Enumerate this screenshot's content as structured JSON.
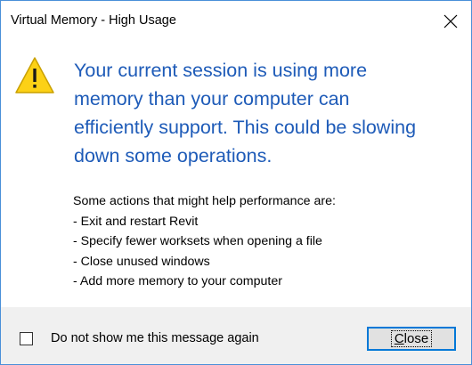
{
  "window": {
    "title": "Virtual Memory - High Usage",
    "close_icon": "close-x-icon",
    "border_color": "#4a90d9"
  },
  "message": {
    "icon": "warning-triangle-icon",
    "headline_lines": [
      "Your current session is using more",
      "memory than your computer can",
      "efficiently support.  This could be slowing",
      "down some operations."
    ],
    "headline_color": "#1e5bb8",
    "help_lines": [
      "Some actions that might help performance are:",
      "- Exit and restart Revit",
      "- Specify fewer worksets when opening a file",
      "- Close unused windows",
      "- Add more memory to your computer"
    ]
  },
  "footer": {
    "checkbox_label": "Do not show me this message again",
    "checkbox_checked": false,
    "close_button": {
      "access_key": "C",
      "rest": "lose"
    },
    "accent_color": "#0078d7"
  }
}
